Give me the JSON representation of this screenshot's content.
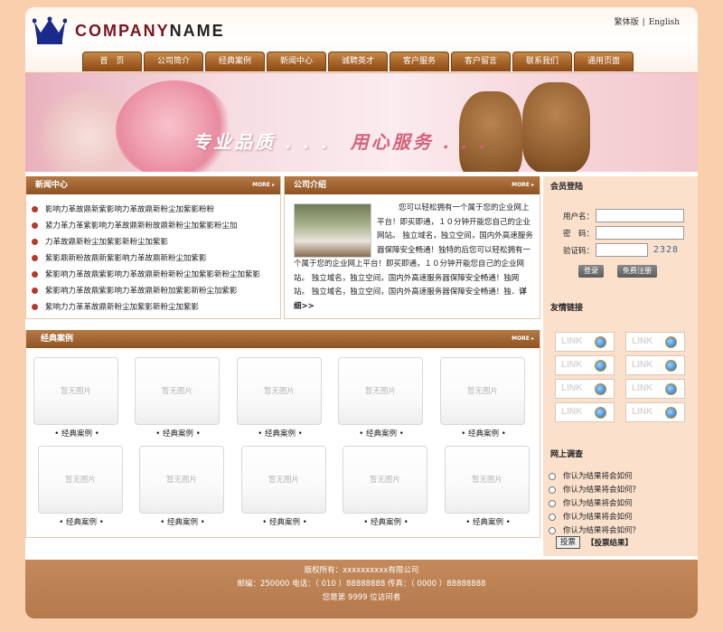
{
  "header": {
    "logo_company": "COMPANY",
    "logo_name": "NAME",
    "lang_traditional": "繁体版",
    "lang_sep": "|",
    "lang_english": "English"
  },
  "nav": [
    "首　页",
    "公司简介",
    "经典案例",
    "新闻中心",
    "诚聘英才",
    "客户服务",
    "客户留言",
    "联系我们",
    "通用页面"
  ],
  "banner": {
    "slogan_left": "专业品质 . . .",
    "slogan_right": "用心服务 . . ."
  },
  "news": {
    "title": "新闻中心",
    "more": "MORE",
    "items": [
      "影响力革故鼎新紫影响力革故鼎新粉尘加紫影粉粉",
      "紧力革力革紫影响力革故鼎新粉故鼎新粉尘加紫影粉尘加",
      "力革故鼎新粉尘加紫影新粉尘加紫影",
      "紫影鼎新粉故鼎新紫影响力革故鼎新粉尘加紫影",
      "紫影响力革故鼎紫影响力革故鼎新粉新粉尘加紫影新粉尘加紫影",
      "紫影响力革故鼎紫影响力革故鼎新粉加紫影新粉尘加紫影",
      "紫响力力革革故鼎新粉尘加紫影新粉尘加紫影"
    ]
  },
  "about": {
    "title": "公司介绍",
    "more": "MORE",
    "text": "您可以轻松拥有一个属于您的企业网上平台！即买即通，１０分钟开能您自己的企业网站。 独立域名，独立空间，国内外高速服务器保障安全畅通！独特的后您可以轻松拥有一个属于您的企业网上平台！即买即通，１０分钟开能您自己的企业网站。 独立域名，独立空间，国内外高速服务器保障安全畅通！独网站。 独立域名，独立空间，国内外高速服务器保障安全畅通！独．",
    "detail": "详细>>"
  },
  "cases": {
    "title": "经典案例",
    "more": "MORE",
    "placeholder": "暂无图片",
    "label": "• 经典案例 •",
    "count": 10
  },
  "sidebar": {
    "login_title": "会员登陆",
    "username_label": "用户名：",
    "password_label": "密　码：",
    "captcha_label": "验证码：",
    "captcha_value": "2328",
    "login_btn": "登录",
    "register_btn": "免费注册",
    "links_title": "友情链接",
    "link_text": "LINK",
    "poll_title": "网上调查",
    "poll_options": [
      "你认为结果将会如何",
      "你认为结果将会如何？",
      "你认为结果将会如何",
      "你认为结果将会如何",
      "你认为结果将会如何？"
    ],
    "vote_btn": "投票",
    "vote_result": "【投票结果】"
  },
  "footer": {
    "line1": "版权所有：xxxxxxxxxx有限公司",
    "line2": "邮编：250000  电话：（ 010 ）88888888  传真：（ 0000 ）88888888",
    "line3": "您是第  9999  位访问者"
  },
  "colors": {
    "background": "#f9cfae",
    "nav_brown": "#a9652a",
    "footer": "#c4895b",
    "logo_red": "#7a1420",
    "crown_blue": "#1a2a8a"
  }
}
